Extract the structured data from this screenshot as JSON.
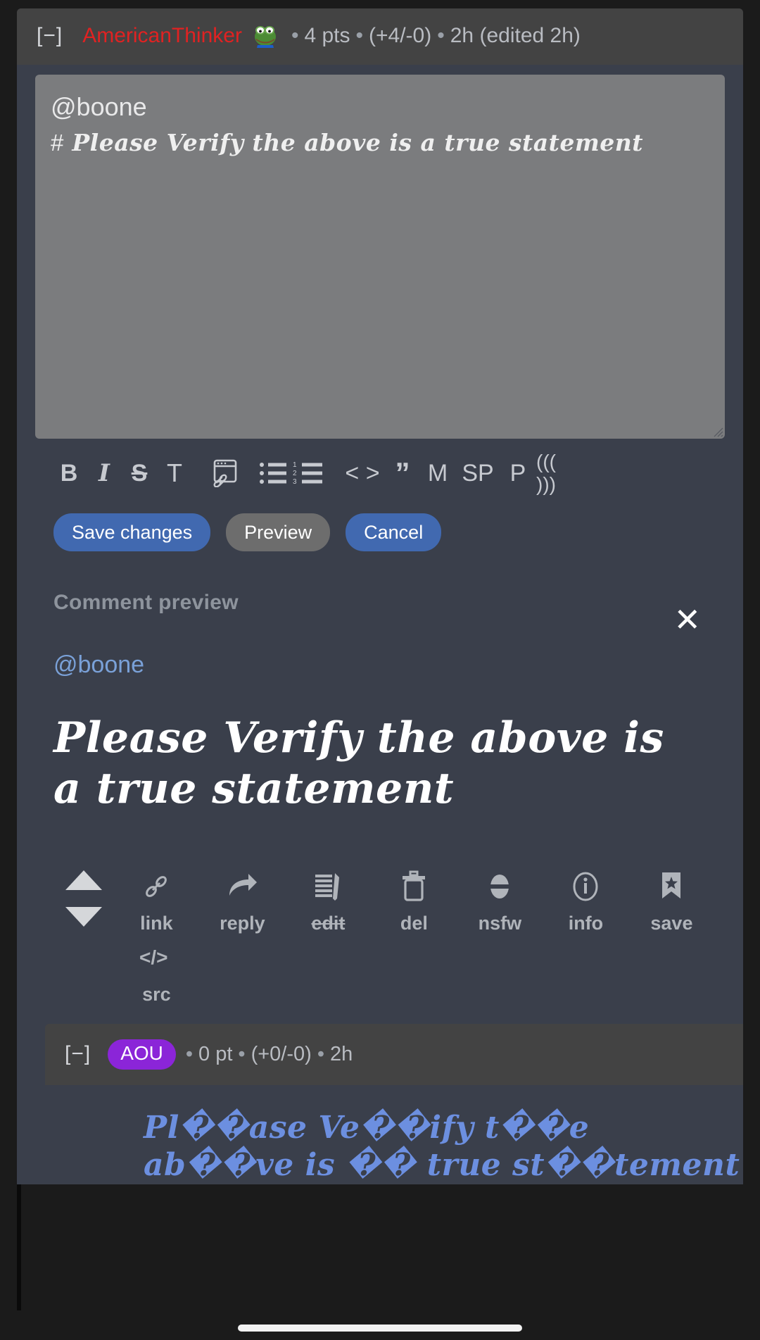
{
  "comment": {
    "collapse_toggle": "[−]",
    "username": "AmericanThinker",
    "flair_icon": "pepe-frog-emoji",
    "points": "4 pts",
    "vote_breakdown": "(+4/-0)",
    "age": "2h (edited 2h)",
    "separator": "•"
  },
  "editor": {
    "textarea_line1": "@boone",
    "textarea_hash": "#",
    "textarea_line2": "Please Verify the above is a true statement",
    "textarea_value": "@boone\n# Please Verify the above is a true statement",
    "resize_handle": "resize-grip"
  },
  "format_toolbar": [
    {
      "name": "bold-button",
      "label": "B",
      "style": "bold"
    },
    {
      "name": "italic-button",
      "label": "I",
      "style": "ital"
    },
    {
      "name": "strikethrough-button",
      "label": "S",
      "style": "strike"
    },
    {
      "name": "heading-button",
      "label": "T",
      "style": "tee"
    },
    {
      "name": "insert-link-button",
      "label": "link-window-icon",
      "style": "icon"
    },
    {
      "name": "bullet-list-button",
      "label": "bullet-list-icon",
      "style": "icon"
    },
    {
      "name": "numbered-list-button",
      "label": "numbered-list-icon",
      "style": "icon"
    },
    {
      "name": "code-button",
      "label": "< >",
      "style": "code"
    },
    {
      "name": "quote-button",
      "label": "”",
      "style": "quote"
    },
    {
      "name": "markdown-button",
      "label": "M",
      "style": "letter"
    },
    {
      "name": "spoiler-button",
      "label": "SP",
      "style": "letter"
    },
    {
      "name": "paragraph-button",
      "label": "P",
      "style": "letter"
    },
    {
      "name": "echo-button",
      "label": "((( )))",
      "style": "echo"
    }
  ],
  "buttons": {
    "save": "Save changes",
    "preview": "Preview",
    "cancel": "Cancel"
  },
  "preview": {
    "title": "Comment preview",
    "close_label": "✕",
    "mention": "@boone",
    "heading": "Please Verify the above is a true statement"
  },
  "actions": {
    "upvote": "upvote-arrow",
    "downvote": "downvote-arrow",
    "items": [
      {
        "name": "link-action",
        "label": "link",
        "icon": "chain-link-icon",
        "struck": false
      },
      {
        "name": "reply-action",
        "label": "reply",
        "icon": "reply-arrow-icon",
        "struck": false
      },
      {
        "name": "edit-action",
        "label": "edit",
        "icon": "edit-pencil-icon",
        "struck": true
      },
      {
        "name": "delete-action",
        "label": "del",
        "icon": "trash-icon",
        "struck": false
      },
      {
        "name": "nsfw-action",
        "label": "nsfw",
        "icon": "no-entry-icon",
        "struck": false
      },
      {
        "name": "info-action",
        "label": "info",
        "icon": "info-circle-icon",
        "struck": false
      },
      {
        "name": "save-action",
        "label": "save",
        "icon": "bookmark-star-icon",
        "struck": false
      },
      {
        "name": "source-action",
        "label": "src",
        "icon": "code-brackets-icon",
        "struck": false
      }
    ]
  },
  "child_comment": {
    "collapse_toggle": "[−]",
    "badge": "AOU",
    "points": "0 pt",
    "vote_breakdown": "(+0/-0)",
    "age": "2h",
    "separator": "•",
    "quote_line1": "Pl��ase Ve��ify t��e",
    "quote_line2": "ab��ve is �� true st��tement"
  },
  "colors": {
    "page_bg": "#1b1b1b",
    "card_bg": "#3a3f4b",
    "header_bg": "#434343",
    "textarea_bg": "#7b7c7e",
    "username_red": "#e02222",
    "primary_blue": "#4169b0",
    "secondary_gray": "#6d6d6d",
    "badge_purple": "#8b25d8",
    "mention_blue": "#7aa1d8",
    "quote_blue": "#6c8fe0"
  }
}
